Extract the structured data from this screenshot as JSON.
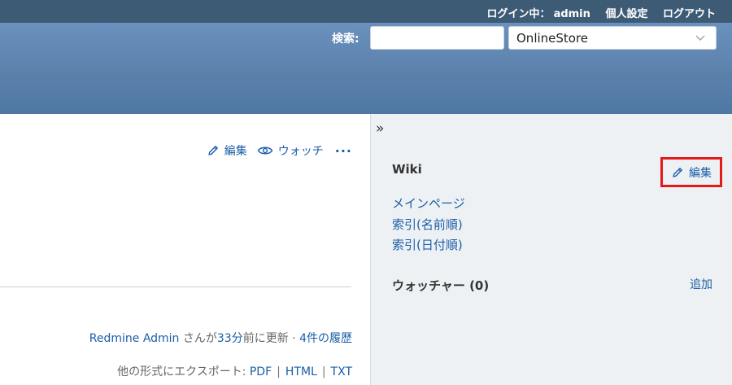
{
  "top_menu": {
    "login_label": "ログイン中：",
    "user": "admin",
    "my_account": "個人設定",
    "logout": "ログアウト"
  },
  "header": {
    "search_label": "検索:",
    "search_value": "",
    "project_select": "OnlineStore"
  },
  "main": {
    "contextual": {
      "edit": "編集",
      "watch": "ウォッチ",
      "more": "···"
    },
    "updated": {
      "author": "Redmine Admin",
      "text_san": " さんが",
      "age": "33分",
      "text_ago": "前に更新 · ",
      "history": "4件の履歴"
    },
    "export": {
      "label": "他の形式にエクスポート: ",
      "pdf": "PDF",
      "html": "HTML",
      "txt": "TXT",
      "sep": "|"
    }
  },
  "sidebar": {
    "toggle": "»",
    "wiki_title": "Wiki",
    "wiki_edit": "編集",
    "links": [
      "メインページ",
      "索引(名前順)",
      "索引(日付順)"
    ],
    "watchers_title": "ウォッチャー (0)",
    "add": "追加"
  },
  "colors": {
    "top_bar": "#3e5b76",
    "header": "#628ab8",
    "link": "#1b5ea8",
    "highlight": "#e21a1a",
    "sidebar_bg": "#eef1f4"
  }
}
